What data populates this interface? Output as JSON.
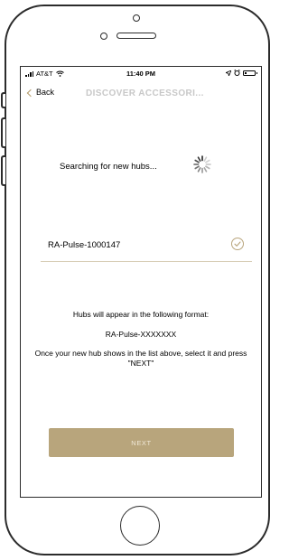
{
  "status_bar": {
    "carrier": "AT&T",
    "time": "11:40 PM",
    "battery_level": 0.35
  },
  "nav": {
    "back_label": "Back",
    "title": "DISCOVER ACCESSORI..."
  },
  "searching": {
    "text": "Searching for new hubs..."
  },
  "hub_list": [
    {
      "name": "RA-Pulse-1000147",
      "status_icon": "check-circle-icon"
    }
  ],
  "info": {
    "format_intro": "Hubs will appear in the following format:",
    "format_example": "RA-Pulse-XXXXXXX",
    "instruction": "Once your new hub shows in the list above, select it and press \"NEXT\""
  },
  "actions": {
    "next_label": "NEXT"
  },
  "colors": {
    "accent": "#b8a57c",
    "accent_text": "#efe7d6",
    "divider": "#d7cdb6",
    "title_muted": "#c8c8c8"
  }
}
